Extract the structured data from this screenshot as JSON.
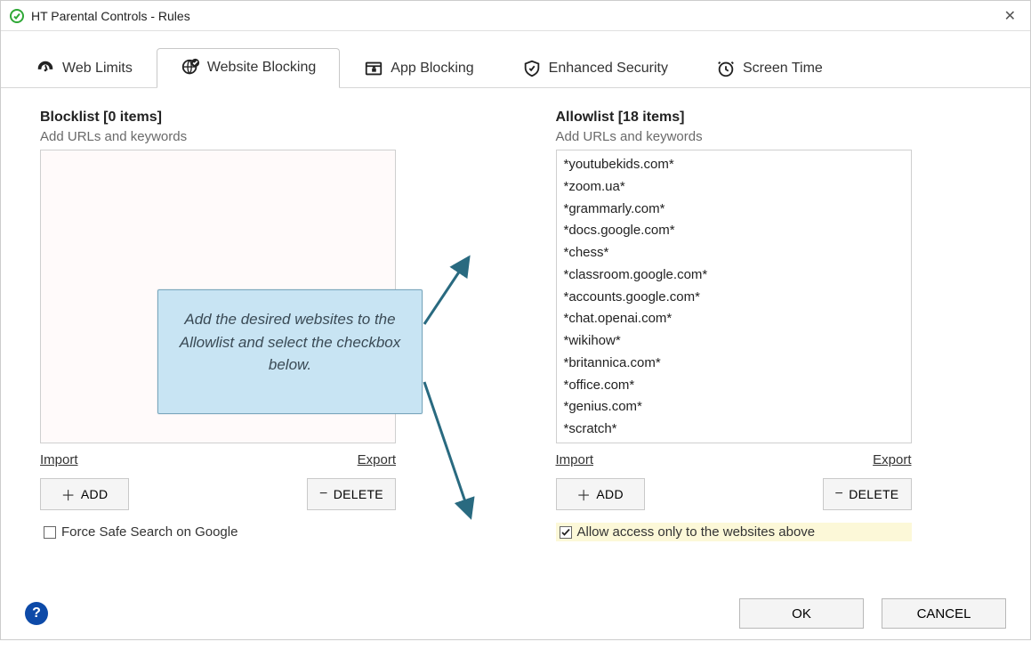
{
  "window": {
    "title": "HT Parental Controls - Rules"
  },
  "tabs": {
    "web_limits": "Web Limits",
    "website_blocking": "Website Blocking",
    "app_blocking": "App Blocking",
    "enhanced_security": "Enhanced Security",
    "screen_time": "Screen Time"
  },
  "blocklist": {
    "title": "Blocklist [0 items]",
    "subtitle": "Add URLs and keywords",
    "items": []
  },
  "allowlist": {
    "title": "Allowlist [18 items]",
    "subtitle": "Add URLs and keywords",
    "items": [
      "*youtubekids.com*",
      "*zoom.ua*",
      "*grammarly.com*",
      "*docs.google.com*",
      "*chess*",
      "*classroom.google.com*",
      "*accounts.google.com*",
      "*chat.openai.com*",
      "*wikihow*",
      "*britannica.com*",
      "*office.com*",
      "*genius.com*",
      "*scratch*"
    ]
  },
  "links": {
    "import": "Import",
    "export": "Export"
  },
  "buttons": {
    "add": "ADD",
    "delete": "DELETE",
    "ok": "OK",
    "cancel": "CANCEL"
  },
  "checks": {
    "force_safe_search": "Force Safe Search on Google",
    "allow_only": "Allow access only to the websites above"
  },
  "callout_text": "Add the desired websites to the Allowlist and select the checkbox below.",
  "colors": {
    "callout_bg": "#c8e4f3",
    "callout_border": "#7aa7bd",
    "highlight": "#fcf8d8"
  }
}
